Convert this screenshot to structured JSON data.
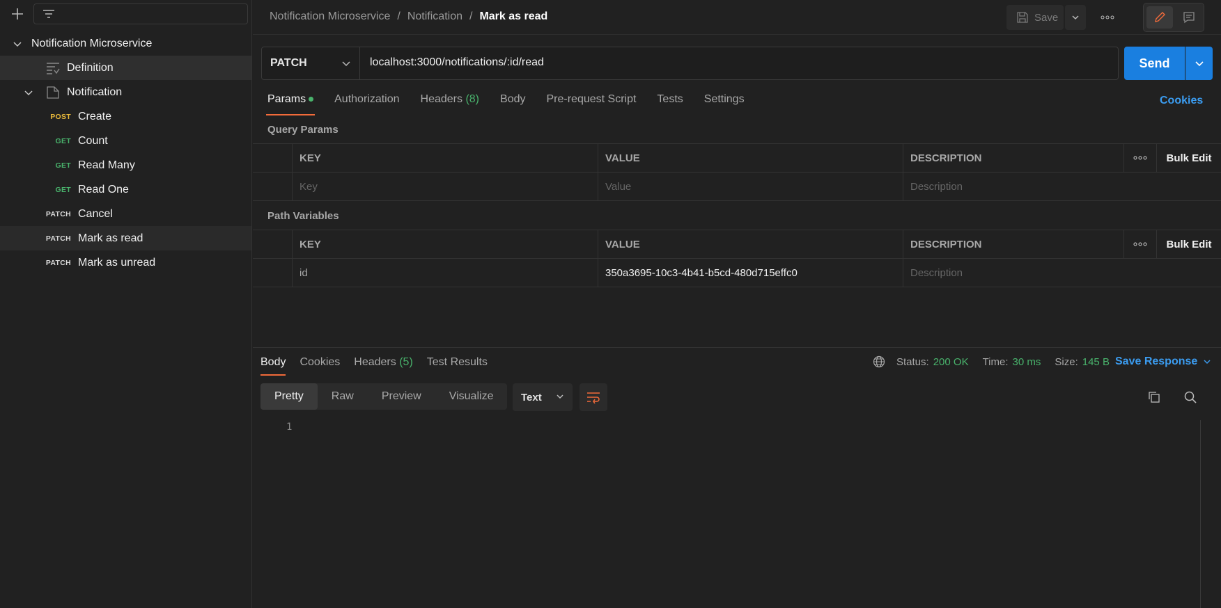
{
  "sidebar": {
    "tree": [
      {
        "label": "Notification Microservice"
      },
      {
        "label": "Definition"
      },
      {
        "label": "Notification"
      },
      {
        "method": "POST",
        "label": "Create"
      },
      {
        "method": "GET",
        "label": "Count"
      },
      {
        "method": "GET",
        "label": "Read Many"
      },
      {
        "method": "GET",
        "label": "Read One"
      },
      {
        "method": "PATCH",
        "label": "Cancel"
      },
      {
        "method": "PATCH",
        "label": "Mark as read"
      },
      {
        "method": "PATCH",
        "label": "Mark as unread"
      }
    ]
  },
  "header": {
    "breadcrumb": [
      "Notification Microservice",
      "/",
      "Notification",
      "/",
      "Mark as read"
    ],
    "save_label": "Save"
  },
  "request": {
    "method": "PATCH",
    "url": "localhost:3000/notifications/:id/read",
    "send_label": "Send",
    "tabs": [
      {
        "label": "Params"
      },
      {
        "label": "Authorization"
      },
      {
        "label": "Headers",
        "count": "(8)"
      },
      {
        "label": "Body"
      },
      {
        "label": "Pre-request Script"
      },
      {
        "label": "Tests"
      },
      {
        "label": "Settings"
      }
    ],
    "cookies_label": "Cookies"
  },
  "query_params": {
    "title": "Query Params",
    "headers": [
      "KEY",
      "VALUE",
      "DESCRIPTION"
    ],
    "bulk_edit": "Bulk Edit",
    "placeholders": {
      "key": "Key",
      "value": "Value",
      "description": "Description"
    }
  },
  "path_variables": {
    "title": "Path Variables",
    "headers": [
      "KEY",
      "VALUE",
      "DESCRIPTION"
    ],
    "bulk_edit": "Bulk Edit",
    "rows": [
      {
        "key": "id",
        "value": "350a3695-10c3-4b41-b5cd-480d715effc0",
        "description": "Description"
      }
    ]
  },
  "response": {
    "tabs": [
      {
        "label": "Body"
      },
      {
        "label": "Cookies"
      },
      {
        "label": "Headers",
        "count": "(5)"
      },
      {
        "label": "Test Results"
      }
    ],
    "status_label": "Status:",
    "status_value": "200 OK",
    "time_label": "Time:",
    "time_value": "30 ms",
    "size_label": "Size:",
    "size_value": "145 B",
    "save_response": "Save Response",
    "formats": [
      "Pretty",
      "Raw",
      "Preview",
      "Visualize"
    ],
    "language": "Text",
    "line_number": "1"
  },
  "colors": {
    "accent": "#f26b3a",
    "primary": "#1a7fe0",
    "success": "#49b36c",
    "post": "#e9b93a"
  }
}
